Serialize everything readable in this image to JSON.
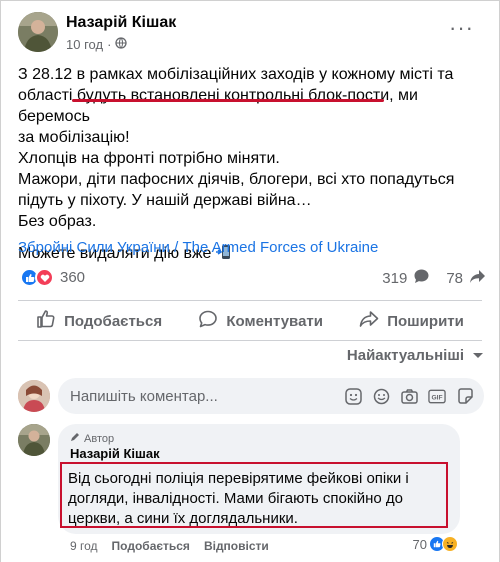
{
  "post": {
    "author": "Назарій Кішак",
    "time": "10 год",
    "more": "···",
    "lines": [
      "З 28.12 в рамках мобілізаційних заходів у кожному місті та",
      "області будуть встановлені контрольні блок-пости, ми беремось",
      "за мобілізацію!",
      "Хлопців на фронті потрібно міняти.",
      "Мажори, діти пафосних діячів, блогери, всі хто попадуться",
      "підуть у піхоту. У нашій державі війна…",
      "Без образ."
    ],
    "last_line": "Можете видаляти дію вже",
    "link": "Збройні Сили України / The Armed Forces of Ukraine"
  },
  "stats": {
    "reactions_count": "360",
    "comments_count": "319",
    "shares_count": "78"
  },
  "actions": {
    "like": "Подобається",
    "comment": "Коментувати",
    "share": "Поширити"
  },
  "sort": {
    "label": "Найактуальніші"
  },
  "composer": {
    "placeholder": "Напишіть коментар..."
  },
  "comment": {
    "badge": "Автор",
    "author": "Назарій Кішак",
    "text": "Від сьогодні поліція перевірятиме фейкові опіки і догляди, інвалідності. Мами бігають спокійно до церкви, а сини їх доглядальники.",
    "time": "9 год",
    "like": "Подобається",
    "reply": "Відповісти",
    "reactions_count": "70"
  },
  "colors": {
    "accent": "#1877f2",
    "highlight": "#c8102e",
    "link": "#1b74e4"
  }
}
